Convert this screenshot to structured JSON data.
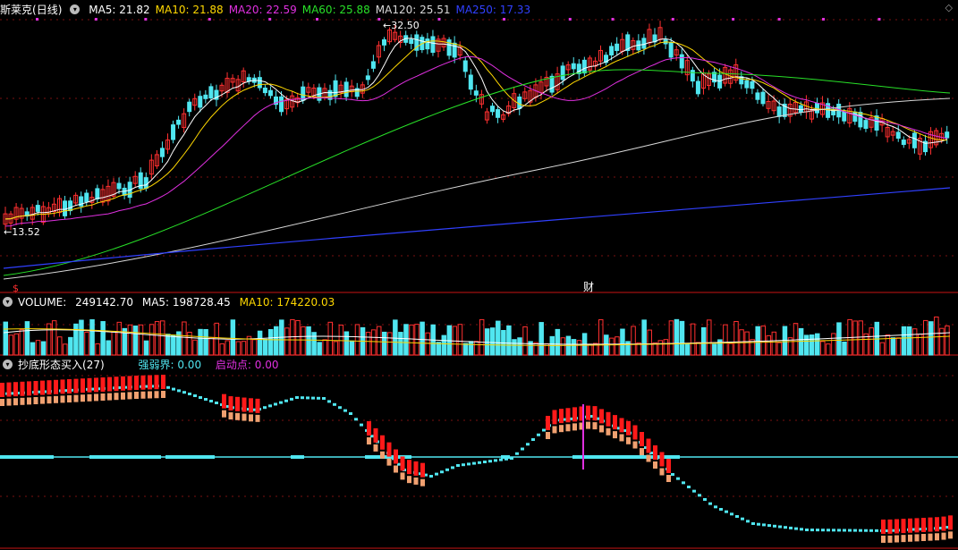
{
  "main_panel": {
    "stock_name": "斯莱克",
    "period": "(日线)",
    "ma": [
      {
        "label": "MA5",
        "value": "21.82",
        "color": "#ffffff"
      },
      {
        "label": "MA10",
        "value": "21.88",
        "color": "#ffd800"
      },
      {
        "label": "MA20",
        "value": "22.59",
        "color": "#e030e0"
      },
      {
        "label": "MA60",
        "value": "25.88",
        "color": "#28e028"
      },
      {
        "label": "MA120",
        "value": "25.51",
        "color": "#d8d8d8"
      },
      {
        "label": "MA250",
        "value": "17.33",
        "color": "#3040ff"
      }
    ],
    "high_label": "32.50",
    "low_label": "13.52",
    "finance_marker": "财",
    "dollar_marker": "$"
  },
  "volume_panel": {
    "title": "VOLUME",
    "value": "249142.70",
    "ma5_label": "MA5",
    "ma5_value": "198728.45",
    "ma10_label": "MA10",
    "ma10_value": "174220.03"
  },
  "indicator_panel": {
    "title": "抄底形态买入",
    "count": "(27)",
    "strength_label": "强弱界",
    "strength_value": "0.00",
    "start_label": "启动点",
    "start_value": "0.00"
  },
  "colors": {
    "up": "#ff3030",
    "down": "#50e6f0",
    "grid": "#7a1010",
    "ma5": "#ffffff",
    "ma10": "#ffd800",
    "ma20": "#e030e0",
    "ma60": "#28e028",
    "ma120": "#d8d8d8",
    "ma250": "#3040ff",
    "buy": "#ff1a1a",
    "buy2": "#f0a070",
    "dots": "#50e6f0",
    "signal": "#e030e0"
  },
  "icons": [
    "chevron-down-icon",
    "diamond-icon"
  ]
}
